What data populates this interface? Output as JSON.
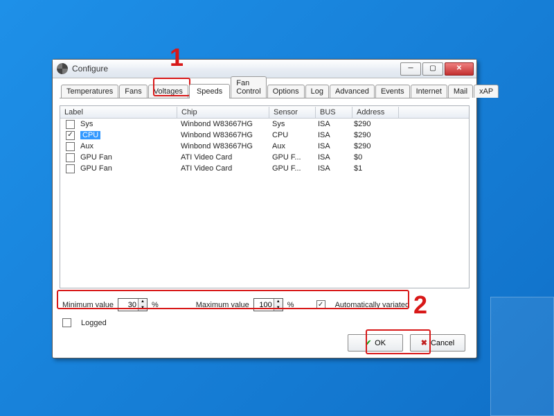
{
  "window": {
    "title": "Configure"
  },
  "tabs": [
    {
      "label": "Temperatures"
    },
    {
      "label": "Fans"
    },
    {
      "label": "Voltages"
    },
    {
      "label": "Speeds",
      "active": true
    },
    {
      "label": "Fan Control"
    },
    {
      "label": "Options"
    },
    {
      "label": "Log"
    },
    {
      "label": "Advanced"
    },
    {
      "label": "Events"
    },
    {
      "label": "Internet"
    },
    {
      "label": "Mail"
    },
    {
      "label": "xAP"
    }
  ],
  "columns": {
    "label": "Label",
    "chip": "Chip",
    "sensor": "Sensor",
    "bus": "BUS",
    "address": "Address"
  },
  "rows": [
    {
      "checked": false,
      "selected": false,
      "label": "Sys",
      "chip": "Winbond W83667HG",
      "sensor": "Sys",
      "bus": "ISA",
      "address": "$290"
    },
    {
      "checked": true,
      "selected": true,
      "label": "CPU",
      "chip": "Winbond W83667HG",
      "sensor": "CPU",
      "bus": "ISA",
      "address": "$290"
    },
    {
      "checked": false,
      "selected": false,
      "label": "Aux",
      "chip": "Winbond W83667HG",
      "sensor": "Aux",
      "bus": "ISA",
      "address": "$290"
    },
    {
      "checked": false,
      "selected": false,
      "label": "GPU Fan",
      "chip": "ATI Video Card",
      "sensor": "GPU F...",
      "bus": "ISA",
      "address": "$0"
    },
    {
      "checked": false,
      "selected": false,
      "label": "GPU Fan",
      "chip": "ATI Video Card",
      "sensor": "GPU F...",
      "bus": "ISA",
      "address": "$1"
    }
  ],
  "controls": {
    "min_label": "Minimum value",
    "min_value": "30",
    "max_label": "Maximum value",
    "max_value": "100",
    "unit": "%",
    "auto_label": "Automatically variated",
    "auto_checked": true,
    "logged_label": "Logged",
    "logged_checked": false
  },
  "buttons": {
    "ok": "OK",
    "cancel": "Cancel"
  },
  "annotations": {
    "one": "1",
    "two": "2"
  }
}
